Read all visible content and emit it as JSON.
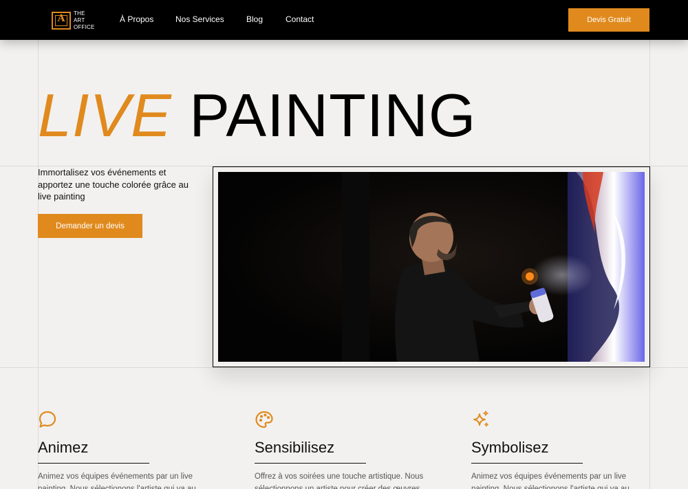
{
  "nav": {
    "logo_letter": "A",
    "logo_lines": [
      "THE",
      "ART",
      "OFFICE"
    ],
    "links": [
      "À Propos",
      "Nos Services",
      "Blog",
      "Contact"
    ],
    "cta": "Devis Gratuit"
  },
  "hero": {
    "title_accent": "LIVE",
    "title_main": "PAINTING",
    "description": "Immortalisez vos événements et apportez une touche colorée grâce au live painting",
    "cta": "Demander un devis"
  },
  "features": [
    {
      "icon": "chat-bubble-icon",
      "title": "Animez",
      "text": "Animez vos équipes événements par un live painting. Nous sélectionons l'artiste qui va au"
    },
    {
      "icon": "palette-icon",
      "title": "Sensibilisez",
      "text": "Offrez à vos soirées une touche artistique. Nous sélectionnons un artiste pour créer des œuvres"
    },
    {
      "icon": "sparkles-icon",
      "title": "Symbolisez",
      "text": "Animez vos équipes événements par un live painting. Nous sélectionons l'artiste qui va au"
    }
  ],
  "colors": {
    "accent": "#e08a1e",
    "background": "#f2f1ef",
    "navbar": "#000000"
  }
}
